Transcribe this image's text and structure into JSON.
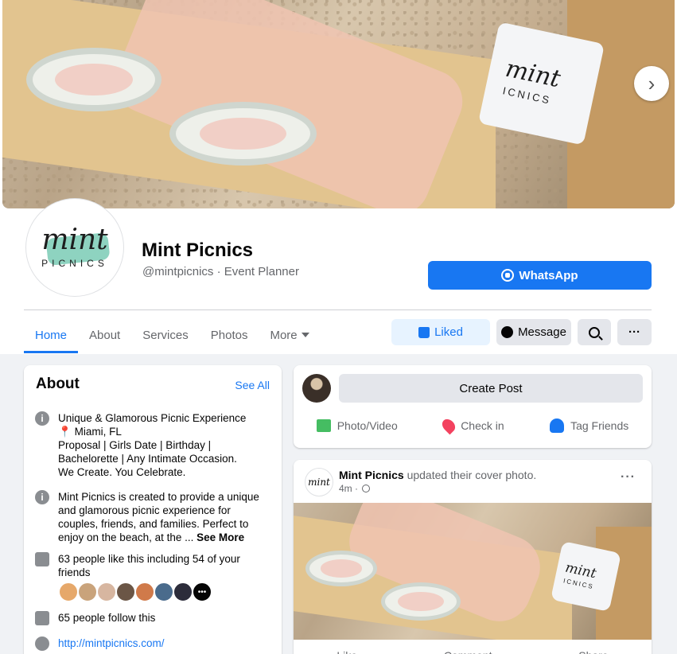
{
  "cover": {
    "pillow_script": "mint",
    "pillow_sub": "ICNICS",
    "next_glyph": "›"
  },
  "profile": {
    "logo_script": "mint",
    "logo_sub": "PICNICS",
    "name": "Mint Picnics",
    "subtitle": "@mintpicnics · Event Planner",
    "whatsapp_label": "WhatsApp"
  },
  "tabs": [
    {
      "label": "Home",
      "active": true
    },
    {
      "label": "About"
    },
    {
      "label": "Services"
    },
    {
      "label": "Photos"
    },
    {
      "label": "More"
    }
  ],
  "actions": {
    "liked_label": "Liked",
    "message_label": "Message",
    "more_glyph": "···"
  },
  "about": {
    "title": "About",
    "see_all": "See All",
    "description": {
      "line1": "Unique & Glamorous Picnic Experience",
      "location": "Miami, FL",
      "line3": "Proposal | Girls Date | Birthday | Bachelorette | Any Intimate Occasion.",
      "line4": "We Create. You Celebrate."
    },
    "long_desc": "Mint Picnics is created to provide a unique and glamorous picnic experience for couples, friends, and families. Perfect to enjoy on the beach, at the ...",
    "see_more": "See More",
    "likes_text": "63 people like this including 54 of your friends",
    "follows_text": "65 people follow this",
    "website": "http://mintpicnics.com/",
    "friend_more_glyph": "•••"
  },
  "create_post": {
    "button_label": "Create Post",
    "actions": [
      "Photo/Video",
      "Check in",
      "Tag Friends"
    ]
  },
  "post": {
    "avatar_text": "mint",
    "author": "Mint Picnics",
    "action": "updated their cover photo.",
    "time": "4m ·",
    "more_glyph": "···",
    "footer": [
      "Like",
      "Comment",
      "Share"
    ]
  },
  "colors": {
    "accent": "#1877f2",
    "liked_bg": "#e7f3ff",
    "button_bg": "#e4e6eb",
    "page_bg": "#f0f2f5"
  }
}
